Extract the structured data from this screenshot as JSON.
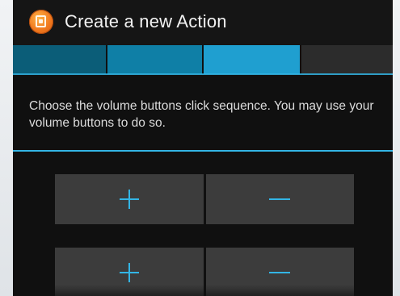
{
  "header": {
    "title": "Create a new Action",
    "icon": "app-orange-icon"
  },
  "wizard": {
    "total_steps": 4,
    "completed_steps": 3,
    "accent_color": "#33b5e5"
  },
  "main": {
    "instruction": "Choose the volume buttons click sequence. You may use your volume buttons to do so."
  },
  "sequence": {
    "rows": [
      {
        "up": "volume-up-icon",
        "down": "volume-down-icon"
      },
      {
        "up": "volume-up-icon",
        "down": "volume-down-icon"
      }
    ]
  }
}
